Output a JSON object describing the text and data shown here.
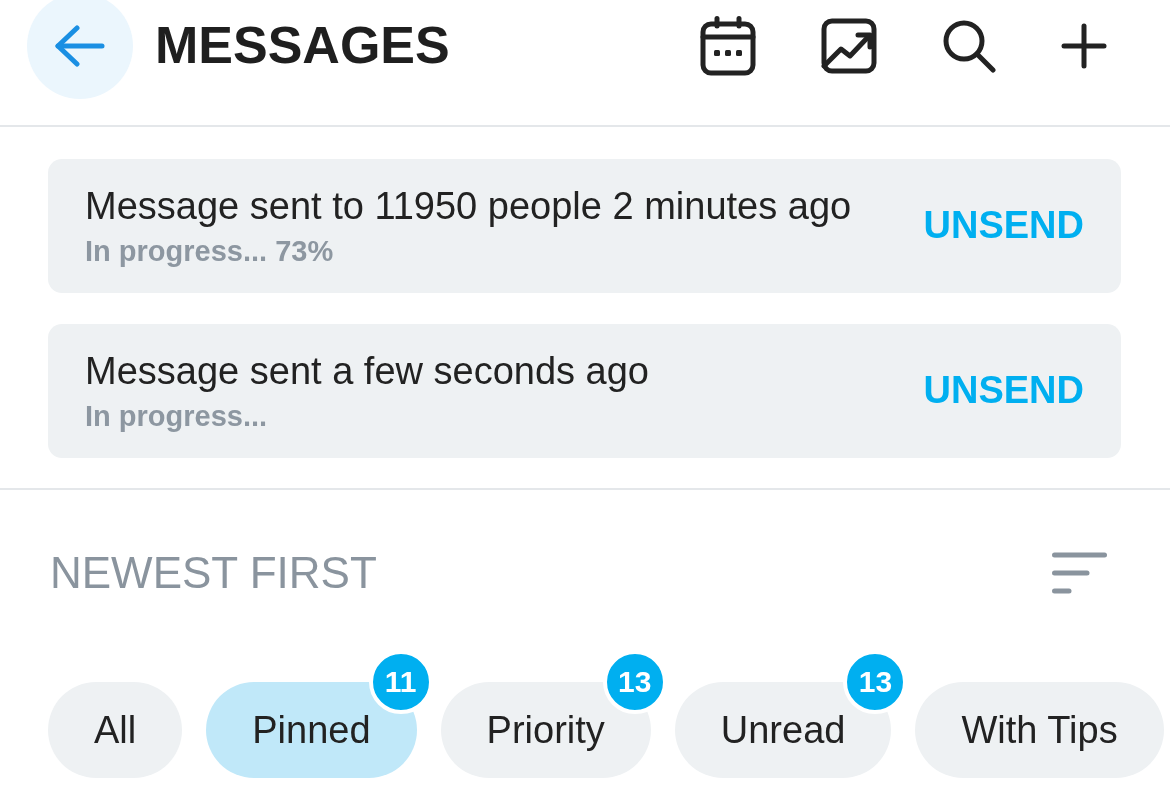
{
  "header": {
    "title": "MESSAGES"
  },
  "notices": [
    {
      "message": "Message sent to 11950 people 2 minutes ago",
      "status": "In progress... 73%",
      "action": "UNSEND"
    },
    {
      "message": "Message sent a few seconds ago",
      "status": "In progress...",
      "action": "UNSEND"
    }
  ],
  "sort": {
    "label": "NEWEST FIRST"
  },
  "filters": [
    {
      "label": "All",
      "selected": false
    },
    {
      "label": "Pinned",
      "selected": true,
      "count": "11"
    },
    {
      "label": "Priority",
      "selected": false,
      "count": "13"
    },
    {
      "label": "Unread",
      "selected": false,
      "count": "13"
    },
    {
      "label": "With Tips",
      "selected": false
    }
  ]
}
